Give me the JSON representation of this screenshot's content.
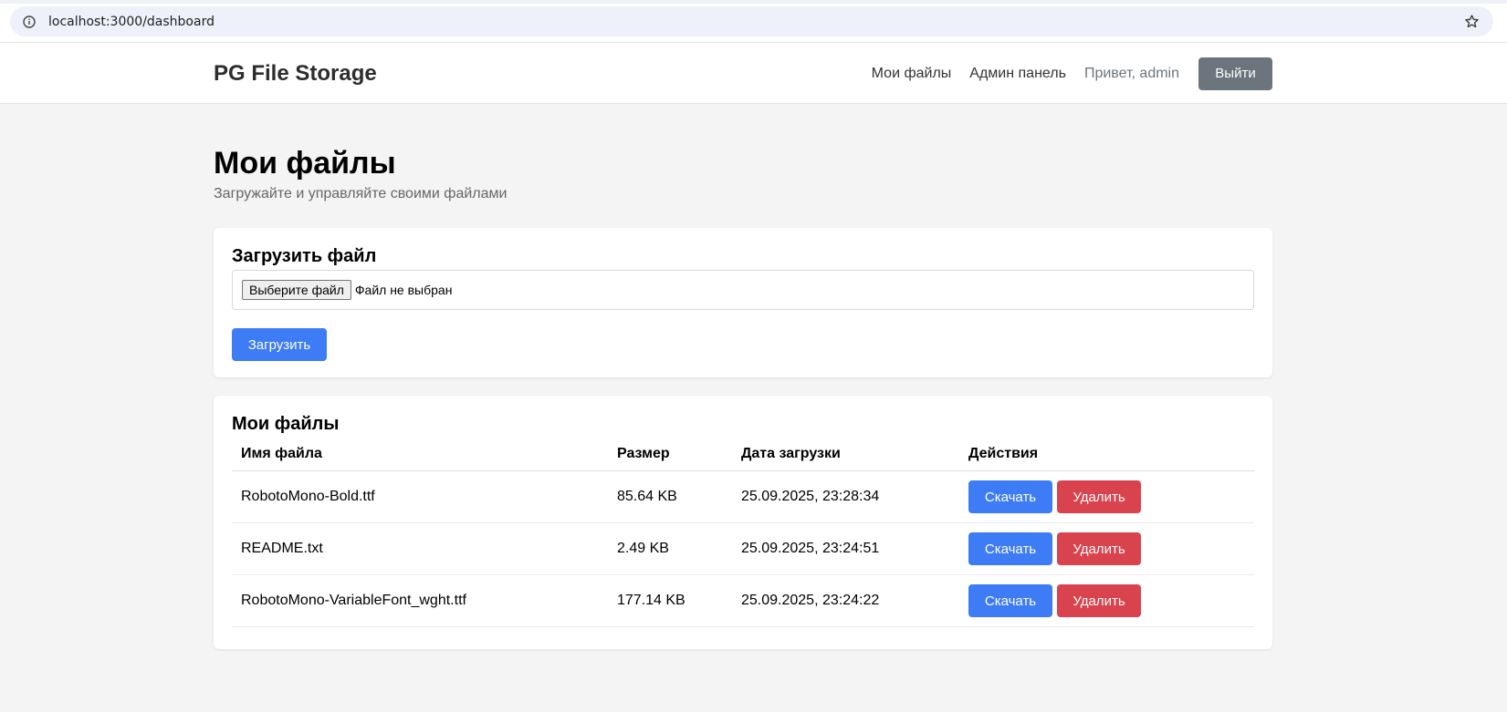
{
  "browser": {
    "url": "localhost:3000/dashboard"
  },
  "navbar": {
    "brand": "PG File Storage",
    "links": [
      "Мои файлы",
      "Админ панель"
    ],
    "greeting": "Привет, admin",
    "logout_label": "Выйти"
  },
  "page": {
    "title": "Мои файлы",
    "subtitle": "Загружайте и управляйте своими файлами"
  },
  "upload": {
    "title": "Загрузить файл",
    "choose_label": "Выберите файл",
    "no_file_text": "Файл не выбран",
    "submit_label": "Загрузить"
  },
  "files": {
    "title": "Мои файлы",
    "columns": [
      "Имя файла",
      "Размер",
      "Дата загрузки",
      "Действия"
    ],
    "rows": [
      {
        "name": "RobotoMono-Bold.ttf",
        "size": "85.64 KB",
        "date": "25.09.2025, 23:28:34"
      },
      {
        "name": "README.txt",
        "size": "2.49 KB",
        "date": "25.09.2025, 23:24:51"
      },
      {
        "name": "RobotoMono-VariableFont_wght.ttf",
        "size": "177.14 KB",
        "date": "25.09.2025, 23:24:22"
      }
    ],
    "download_label": "Скачать",
    "delete_label": "Удалить"
  },
  "colors": {
    "primary": "#3d7cf4",
    "danger": "#d9434d",
    "secondary": "#6c757d"
  }
}
